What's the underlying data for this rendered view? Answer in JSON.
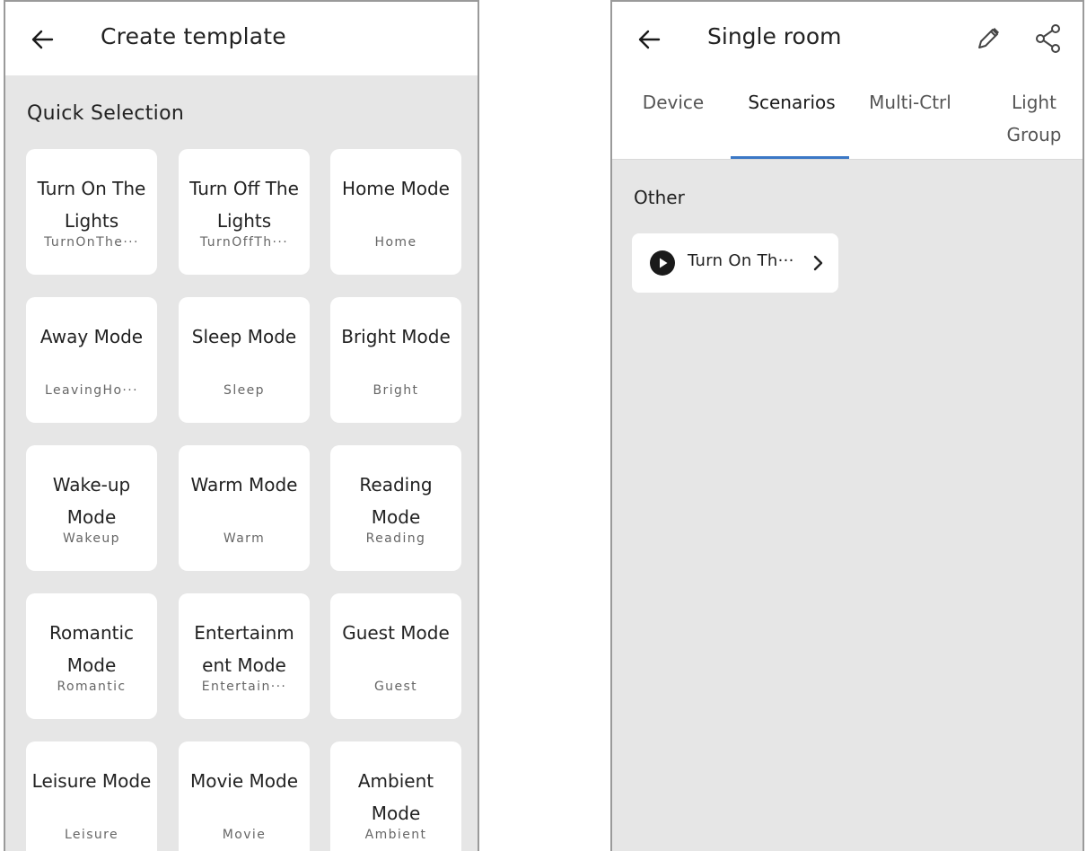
{
  "left": {
    "title": "Create template",
    "section_title": "Quick Selection",
    "templates": [
      {
        "name": "Turn On The Lights",
        "code": "TurnOnThe···"
      },
      {
        "name": "Turn Off The Lights",
        "code": "TurnOffTh···"
      },
      {
        "name": "Home Mode",
        "code": "Home"
      },
      {
        "name": "Away Mode",
        "code": "LeavingHo···"
      },
      {
        "name": "Sleep Mode",
        "code": "Sleep"
      },
      {
        "name": "Bright Mode",
        "code": "Bright"
      },
      {
        "name": "Wake-up Mode",
        "code": "Wakeup"
      },
      {
        "name": "Warm Mode",
        "code": "Warm"
      },
      {
        "name": "Reading Mode",
        "code": "Reading"
      },
      {
        "name": "Romantic Mode",
        "code": "Romantic"
      },
      {
        "name": "Entertainm ent Mode",
        "code": "Entertain···"
      },
      {
        "name": "Guest Mode",
        "code": "Guest"
      },
      {
        "name": "Leisure Mode",
        "code": "Leisure"
      },
      {
        "name": "Movie Mode",
        "code": "Movie"
      },
      {
        "name": "Ambient Mode",
        "code": "Ambient"
      }
    ]
  },
  "right": {
    "title": "Single room",
    "tabs": [
      {
        "label": "Device"
      },
      {
        "label": "Scenarios"
      },
      {
        "label": "Multi-Ctrl"
      },
      {
        "label": "Light Group"
      }
    ],
    "active_tab": "Scenarios",
    "section_label": "Other",
    "scene_chip_label": "Turn On Th···"
  },
  "colors": {
    "accent": "#3b78c6",
    "background": "#e6e6e6",
    "card": "#ffffff"
  },
  "icons": [
    "back-arrow-icon",
    "pencil-icon",
    "share-icon",
    "play-icon",
    "chevron-right-icon"
  ]
}
